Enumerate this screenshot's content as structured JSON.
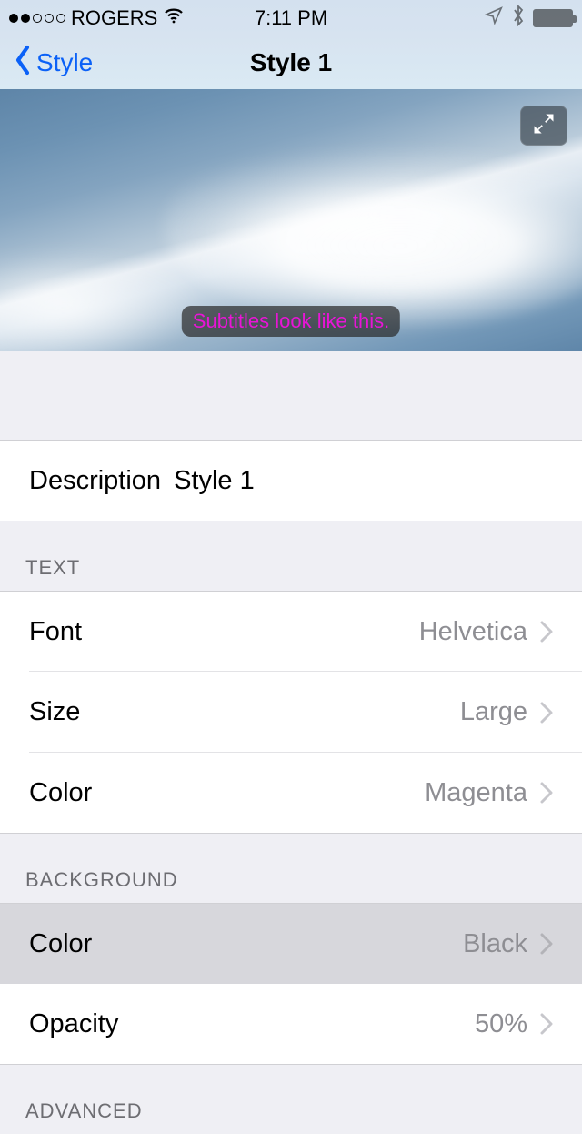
{
  "status": {
    "carrier": "ROGERS",
    "time": "7:11 PM"
  },
  "nav": {
    "back": "Style",
    "title": "Style 1"
  },
  "preview": {
    "subtitle": "Subtitles look like this."
  },
  "description": {
    "label": "Description",
    "value": "Style 1"
  },
  "sections": {
    "text": {
      "header": "TEXT",
      "font": {
        "label": "Font",
        "value": "Helvetica"
      },
      "size": {
        "label": "Size",
        "value": "Large"
      },
      "color": {
        "label": "Color",
        "value": "Magenta"
      }
    },
    "background": {
      "header": "BACKGROUND",
      "color": {
        "label": "Color",
        "value": "Black"
      },
      "opacity": {
        "label": "Opacity",
        "value": "50%"
      }
    },
    "advanced": {
      "header": "ADVANCED"
    }
  }
}
